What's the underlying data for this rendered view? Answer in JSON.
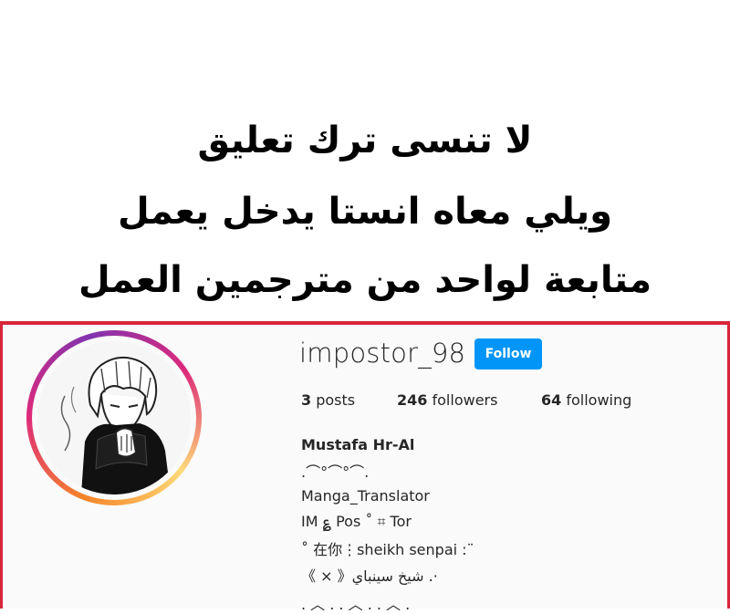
{
  "notice": {
    "line1": "لا تنسى ترك تعليق",
    "line2": "ويلي معاه انستا يدخل يعمل",
    "line3": "متابعة لواحد من مترجمين العمل"
  },
  "profile": {
    "username": "impostor_98",
    "follow_label": "Follow",
    "stats": {
      "posts_count": "3",
      "posts_label": "posts",
      "followers_count": "246",
      "followers_label": "followers",
      "following_count": "64",
      "following_label": "following"
    },
    "bio": {
      "name": "Mustafa Hr-Al",
      "lines": [
        ".⌒°⌒°⌒.",
        "Manga_Translator",
        "IM ؏ Pos ˚ ⌗ Tor",
        "˚ 在你⋮sheikh senpai :¨",
        "《 × 》شيخ سينباي .·",
        ". ︿ . . ︿ . . ︿ ."
      ]
    },
    "colors": {
      "follow": "#0095f6",
      "divider": "#d8263a",
      "text": "#262626"
    }
  }
}
